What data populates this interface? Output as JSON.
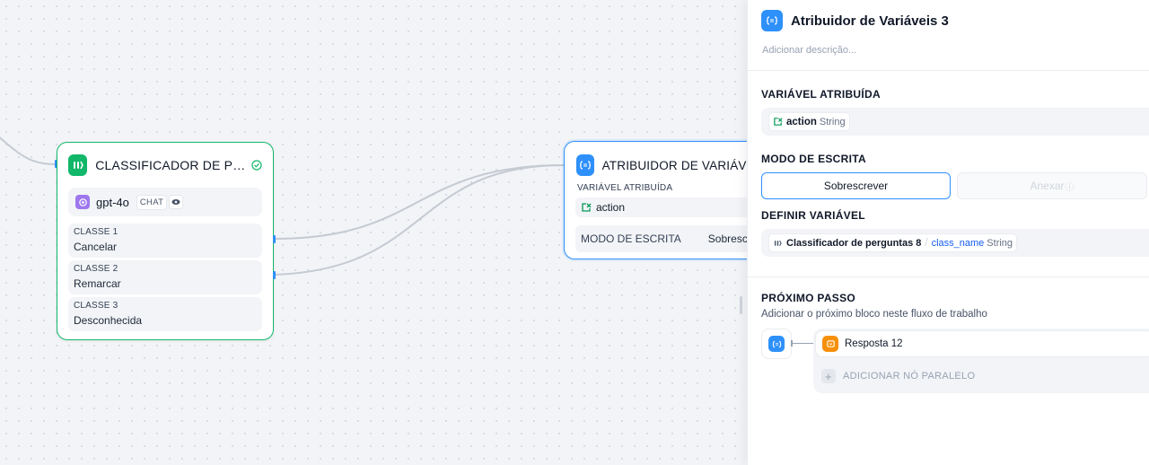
{
  "canvas": {
    "classifier_node": {
      "title": "CLASSIFICADOR DE PERG...",
      "model": "gpt-4o",
      "model_mode": "CHAT",
      "classes": [
        {
          "label": "CLASSE 1",
          "value": "Cancelar"
        },
        {
          "label": "CLASSE 2",
          "value": "Remarcar"
        },
        {
          "label": "CLASSE 3",
          "value": "Desconhecida"
        }
      ]
    },
    "assigner_node": {
      "title": "ATRIBUIDOR DE VARIÁVEIS",
      "var_label": "VARIÁVEL ATRIBUÍDA",
      "var_name": "action",
      "mode_label": "MODO DE ESCRITA",
      "mode_value": "Sobrescrever"
    }
  },
  "panel": {
    "title": "Atribuidor de Variáveis 3",
    "description_placeholder": "Adicionar descrição...",
    "assigned_variable": {
      "label": "VARIÁVEL ATRIBUÍDA",
      "name": "action",
      "type": "String"
    },
    "write_mode": {
      "label": "MODO DE ESCRITA",
      "options": [
        "Sobrescrever",
        "Anexar"
      ],
      "selected": "Sobrescrever"
    },
    "define_variable": {
      "label": "DEFINIR VARIÁVEL",
      "source_node": "Classificador de perguntas 8",
      "separator": "/",
      "source_var": "class_name",
      "type": "String"
    },
    "next_step": {
      "label": "PRÓXIMO PASSO",
      "subtitle": "Adicionar o próximo bloco neste fluxo de trabalho",
      "next_node": "Resposta 12",
      "add_parallel": "ADICIONAR NÓ PARALELO"
    }
  },
  "colors": {
    "accent_blue": "#2e90fa",
    "classifier_green": "#12b76a",
    "llm_purple": "#9e77ed",
    "answer_orange": "#f79009"
  }
}
